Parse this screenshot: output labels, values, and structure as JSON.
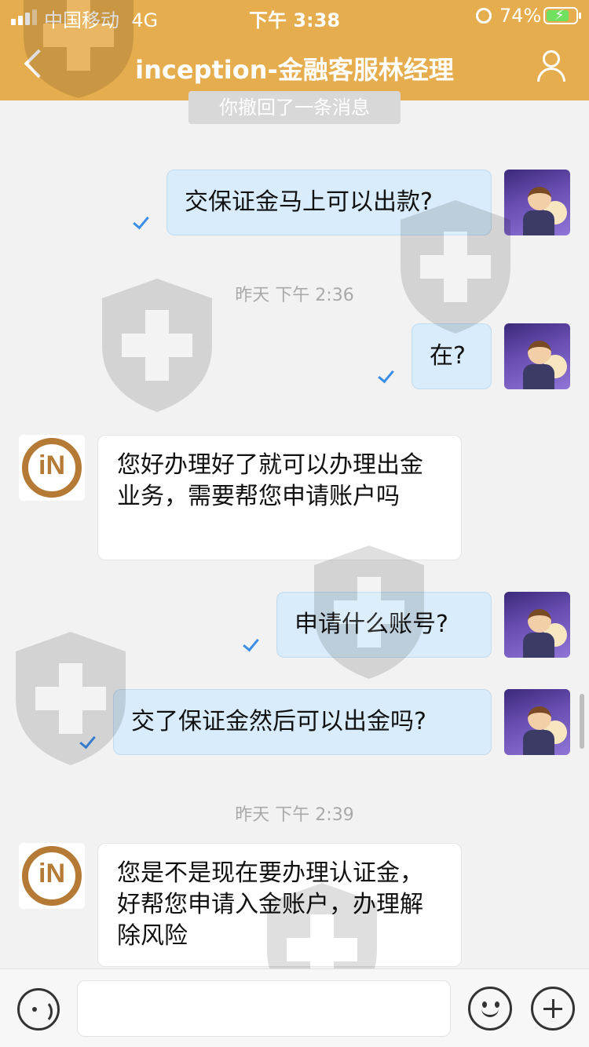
{
  "status_bar": {
    "carrier": "中国移动",
    "network": "4G",
    "time": "下午 3:38",
    "battery_percent": "74%",
    "battery_level": 0.74
  },
  "header": {
    "title": "inception-金融客服林经理",
    "back_icon": "chevron-left-icon",
    "profile_icon": "person-icon",
    "background_color": "#e6ad4e"
  },
  "chat": {
    "recall_notice": "你撤回了一条消息",
    "messages": [
      {
        "side": "out",
        "text": "交保证金马上可以出款?"
      },
      {
        "side": "time",
        "text": "昨天 下午 2:36"
      },
      {
        "side": "out",
        "text": "在?"
      },
      {
        "side": "in",
        "text": "您好办理好了就可以办理出金业务，需要帮您申请账户吗"
      },
      {
        "side": "out",
        "text": "申请什么账号?"
      },
      {
        "side": "out",
        "text": "交了保证金然后可以出金吗?"
      },
      {
        "side": "time",
        "text": "昨天 下午 2:39"
      },
      {
        "side": "in",
        "text": "您是不是现在要办理认证金，好帮您申请入金账户，办理解除风险"
      }
    ]
  },
  "input_bar": {
    "placeholder": "",
    "voice_icon": "voice-icon",
    "emoji_icon": "emoji-icon",
    "plus_icon": "plus-icon"
  },
  "colors": {
    "outgoing_bubble": "#d9ecfb",
    "incoming_bubble": "#ffffff",
    "read_check": "#3b8ee8"
  }
}
